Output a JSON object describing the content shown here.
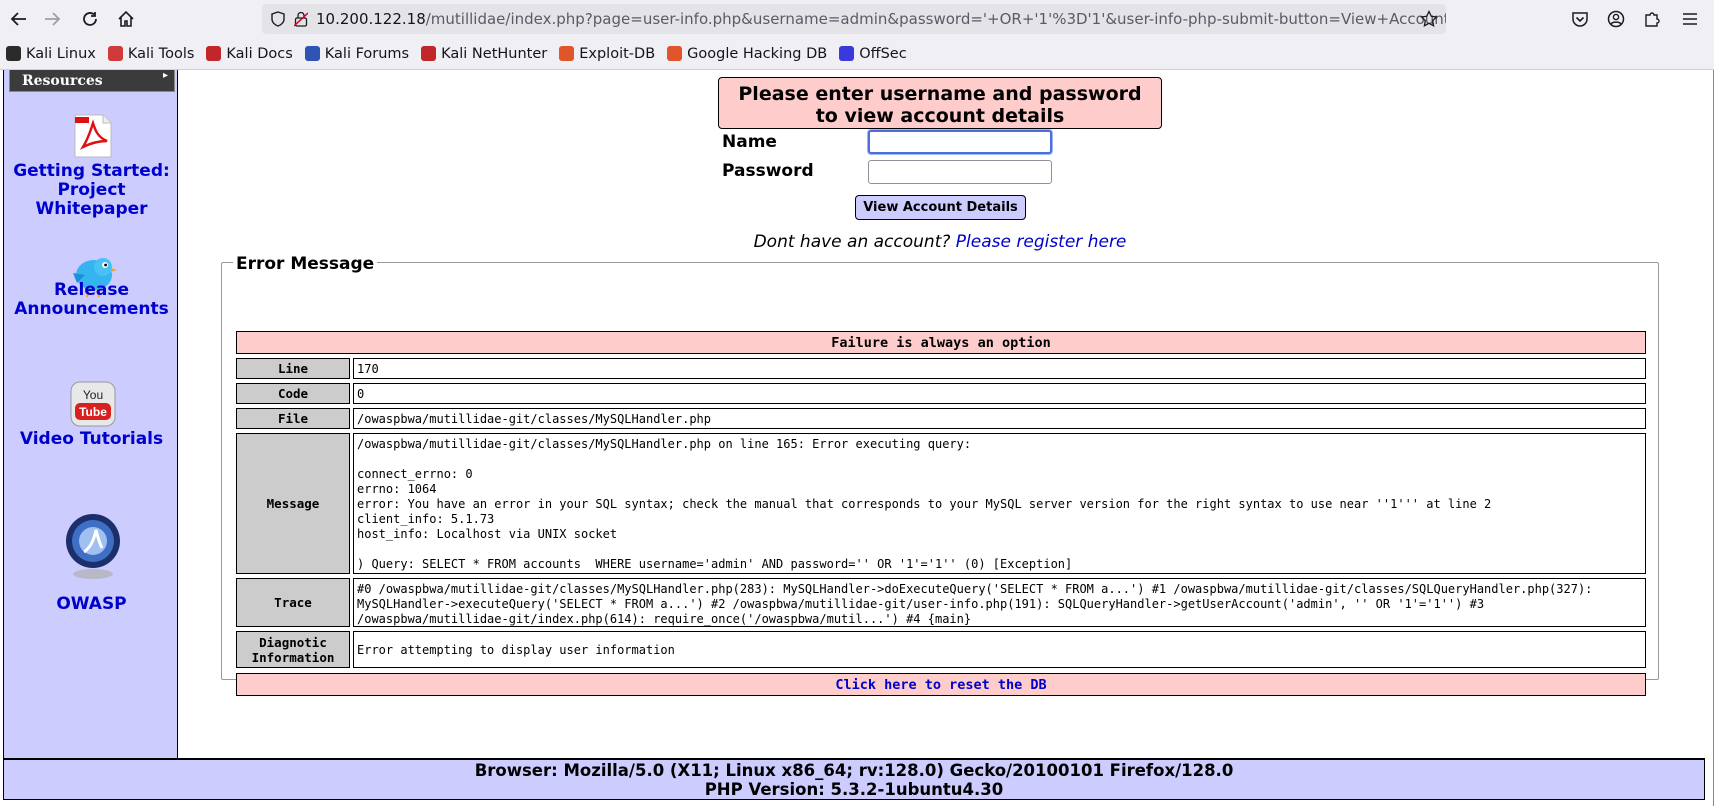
{
  "browser": {
    "url_host": "10.200.122.18",
    "url_rest": "/mutillidae/index.php?page=user-info.php&username=admin&password='+OR+'1'%3D'1'&user-info-php-submit-button=View+Account+Details"
  },
  "bookmarks": [
    {
      "label": "Kali Linux",
      "icon": "kali-dragon-icon",
      "color": "#2b2b2b"
    },
    {
      "label": "Kali Tools",
      "icon": "kali-tools-icon",
      "color": "#d03a3a"
    },
    {
      "label": "Kali Docs",
      "icon": "kali-docs-icon",
      "color": "#c0262a"
    },
    {
      "label": "Kali Forums",
      "icon": "kali-forums-icon",
      "color": "#2f55b4"
    },
    {
      "label": "Kali NetHunter",
      "icon": "kali-nethunter-icon",
      "color": "#c0262a"
    },
    {
      "label": "Exploit-DB",
      "icon": "exploit-db-icon",
      "color": "#e0552a"
    },
    {
      "label": "Google Hacking DB",
      "icon": "ghdb-icon",
      "color": "#e0552a"
    },
    {
      "label": "OffSec",
      "icon": "offsec-icon",
      "color": "#3a3adb"
    }
  ],
  "sidebar": {
    "menu_label": "Resources",
    "items": [
      {
        "label": "Getting Started: Project Whitepaper",
        "icon": "pdf-icon"
      },
      {
        "label": "Release Announcements",
        "icon": "twitter-bird-icon"
      },
      {
        "label": "Video Tutorials",
        "icon": "youtube-icon"
      },
      {
        "label": "OWASP",
        "icon": "owasp-logo-icon"
      }
    ]
  },
  "login": {
    "title_line1": "Please enter username and password",
    "title_line2": "to view account details",
    "name_label": "Name",
    "password_label": "Password",
    "name_value": "",
    "password_value": "",
    "submit_label": "View Account Details",
    "register_prefix": "Dont have an account?",
    "register_link": "Please register here"
  },
  "error": {
    "legend": "Error Message",
    "banner": "Failure is always an option",
    "rows": [
      {
        "label": "Line",
        "value": "170"
      },
      {
        "label": "Code",
        "value": "0"
      },
      {
        "label": "File",
        "value": "/owaspbwa/mutillidae-git/classes/MySQLHandler.php"
      },
      {
        "label": "Message",
        "value": "/owaspbwa/mutillidae-git/classes/MySQLHandler.php on line 165: Error executing query:\n\nconnect_errno: 0\nerrno: 1064\nerror: You have an error in your SQL syntax; check the manual that corresponds to your MySQL server version for the right syntax to use near ''1''' at line 2\nclient_info: 5.1.73\nhost_info: Localhost via UNIX socket\n\n) Query: SELECT * FROM accounts  WHERE username='admin' AND password='' OR '1'='1'' (0) [Exception]"
      },
      {
        "label": "Trace",
        "value": "#0 /owaspbwa/mutillidae-git/classes/MySQLHandler.php(283): MySQLHandler->doExecuteQuery('SELECT * FROM a...') #1 /owaspbwa/mutillidae-git/classes/SQLQueryHandler.php(327): MySQLHandler->executeQuery('SELECT * FROM a...') #2 /owaspbwa/mutillidae-git/user-info.php(191): SQLQueryHandler->getUserAccount('admin', '' OR '1'='1'') #3 /owaspbwa/mutillidae-git/index.php(614): require_once('/owaspbwa/mutil...') #4 {main}"
      },
      {
        "label": "Diagnotic Information",
        "value": "Error attempting to display user information"
      }
    ],
    "reset_link": "Click here to reset the DB"
  },
  "footer": {
    "browser": "Browser: Mozilla/5.0 (X11; Linux x86_64; rv:128.0) Gecko/20100101 Firefox/128.0",
    "php": "PHP Version: 5.3.2-1ubuntu4.30"
  }
}
